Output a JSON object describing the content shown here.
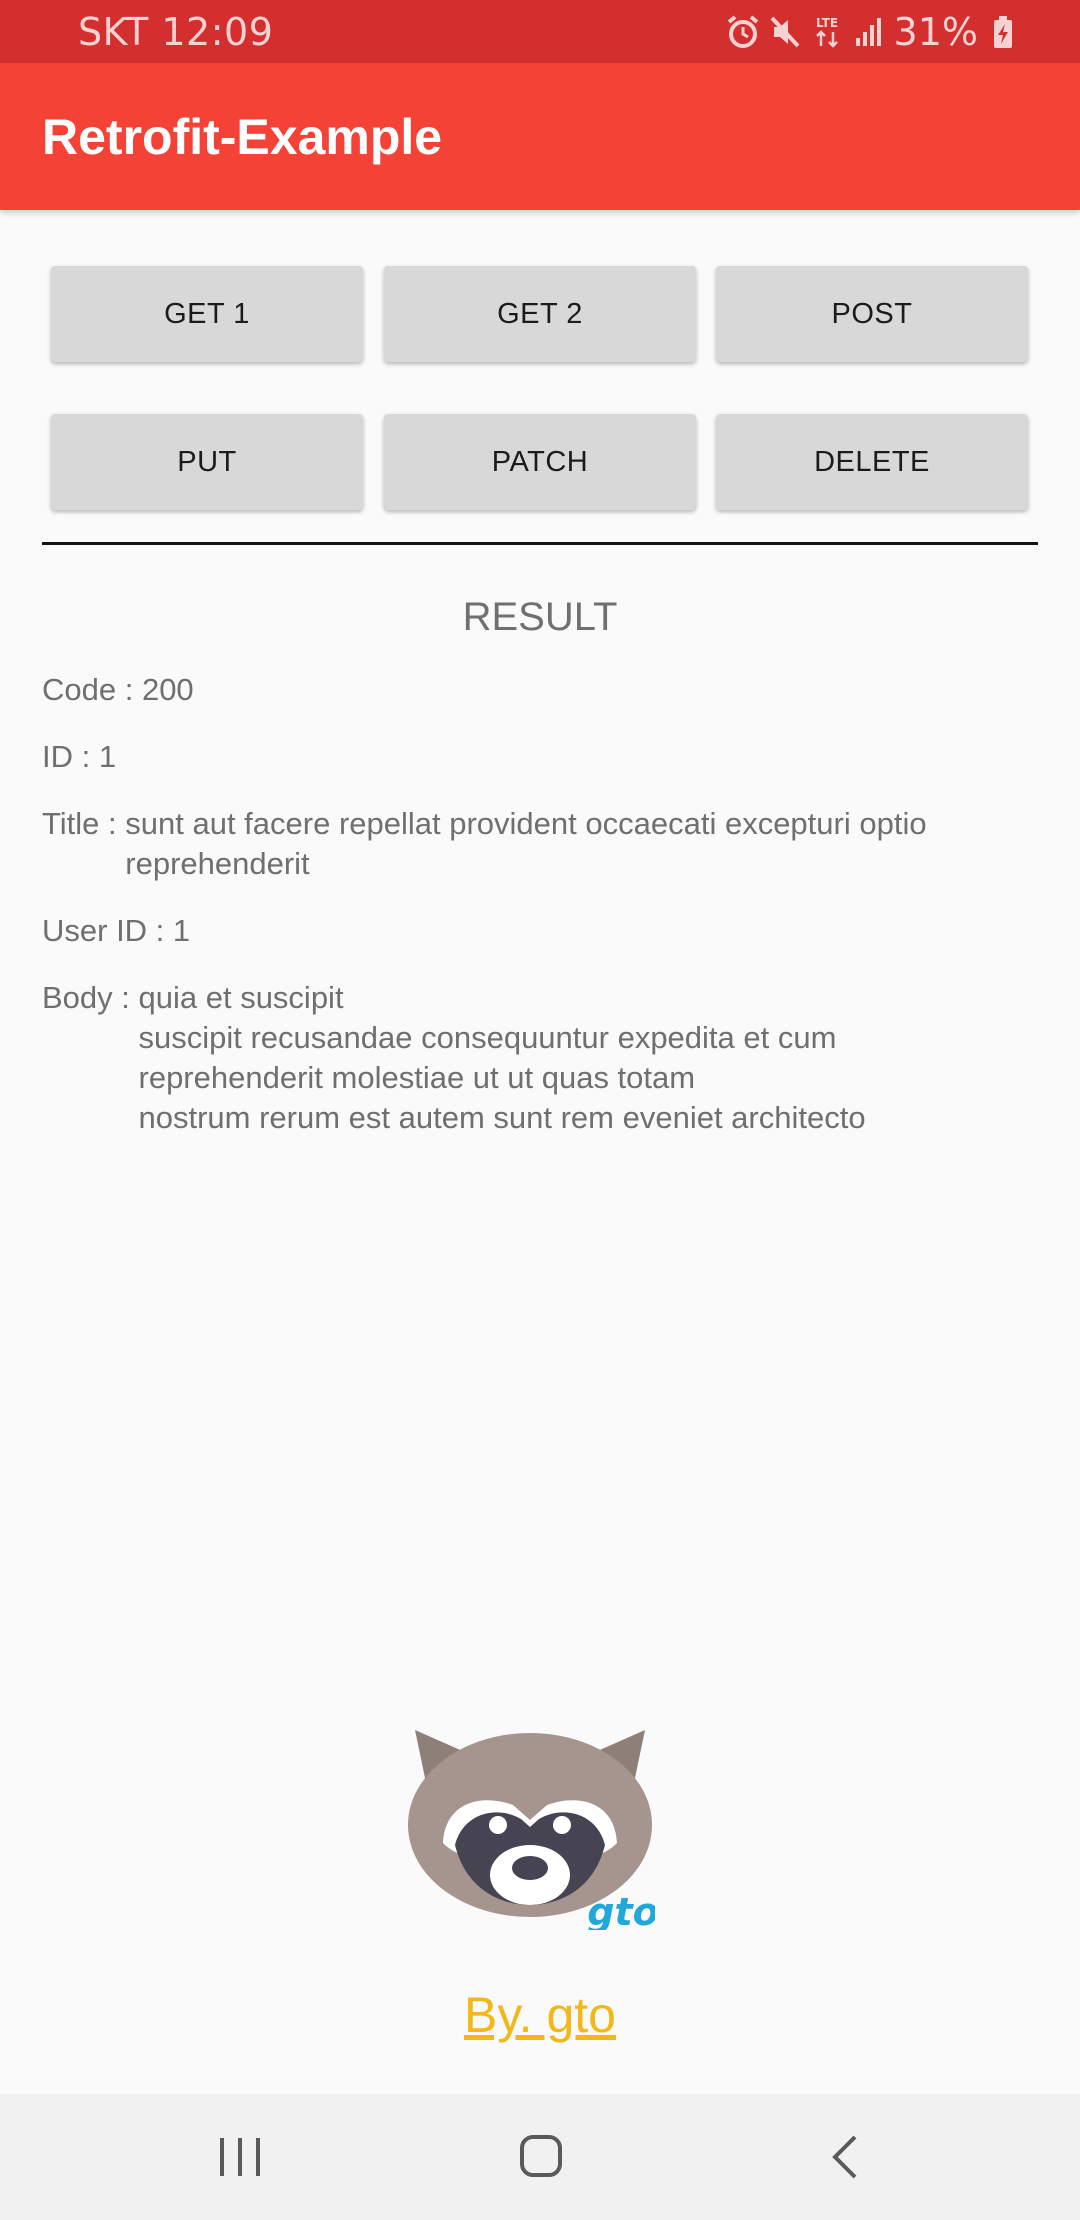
{
  "status_bar": {
    "carrier_time": "SKT 12:09",
    "battery": "31%",
    "network": "LTE"
  },
  "app_bar": {
    "title": "Retrofit-Example"
  },
  "buttons": {
    "get1": "GET 1",
    "get2": "GET 2",
    "post": "POST",
    "put": "PUT",
    "patch": "PATCH",
    "delete": "DELETE"
  },
  "result": {
    "heading": "RESULT",
    "code": {
      "label": "Code : ",
      "value": "200"
    },
    "id": {
      "label": "ID : ",
      "value": "1"
    },
    "title": {
      "label": "Title : ",
      "value": "sunt aut facere repellat provident occaecati excepturi optio\nreprehenderit"
    },
    "user_id": {
      "label": "User ID : ",
      "value": "1"
    },
    "body": {
      "label": "Body : ",
      "value": "quia et suscipit\nsuscipit recusandae consequuntur expedita et cum\nreprehenderit molestiae ut ut quas totam\nnostrum rerum est autem sunt rem eveniet architecto"
    }
  },
  "logo": {
    "badge": "gto",
    "icon": "raccoon-icon"
  },
  "footer": {
    "link": "By. gto",
    "link_color": "#f3b718"
  },
  "colors": {
    "status_bar": "#d32f2f",
    "app_bar": "#f44336",
    "button": "#d7d8d7"
  },
  "nav": {
    "recents_icon": "recents-icon",
    "home_icon": "home-icon",
    "back_icon": "back-icon"
  }
}
